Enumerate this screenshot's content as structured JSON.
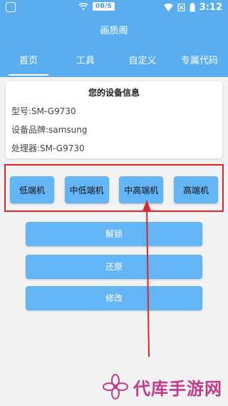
{
  "status_bar": {
    "network_speed": "0B/S",
    "time": "3:12"
  },
  "app": {
    "title": "画质阁"
  },
  "tabs": [
    {
      "label": "首页"
    },
    {
      "label": "工具"
    },
    {
      "label": "自定义"
    },
    {
      "label": "专属代码"
    }
  ],
  "device_info": {
    "title": "您的设备信息",
    "model": "型号:SM-G9730",
    "brand": "设备品牌:samsung",
    "processor": "处理器:SM-G9730"
  },
  "tiers": [
    {
      "label": "低端机"
    },
    {
      "label": "中低端机"
    },
    {
      "label": "中高端机"
    },
    {
      "label": "高端机"
    }
  ],
  "actions": {
    "unlock": "解锁",
    "restore": "还原",
    "modify": "修改"
  },
  "watermark": {
    "text": "代库手游网"
  },
  "colors": {
    "primary": "#5aaef0",
    "button": "#64b5f6",
    "highlight": "#e0242a",
    "watermark": "#c43a89"
  }
}
